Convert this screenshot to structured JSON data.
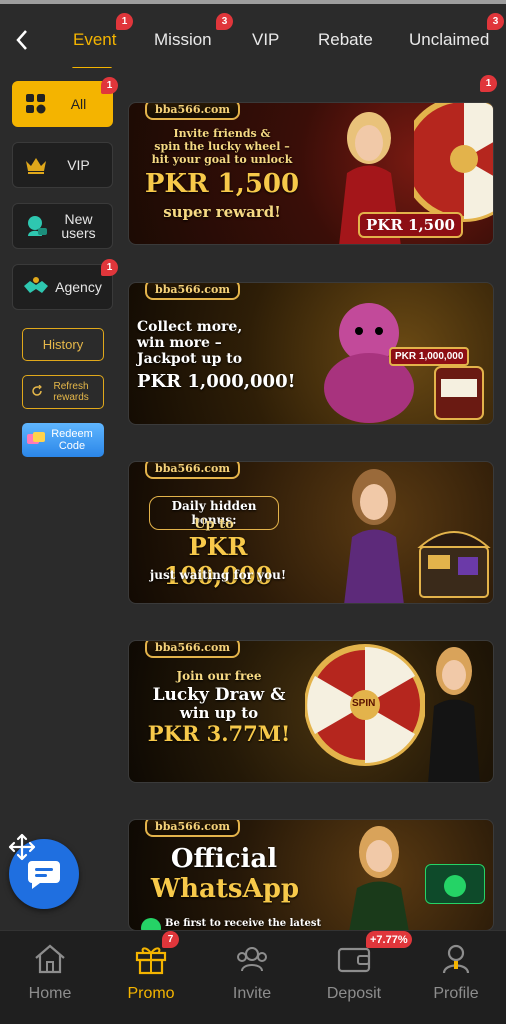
{
  "topbar": {
    "tabs": [
      {
        "label": "Event",
        "badge": "1"
      },
      {
        "label": "Mission",
        "badge": "3"
      },
      {
        "label": "VIP",
        "badge": ""
      },
      {
        "label": "Rebate",
        "badge": ""
      },
      {
        "label": "Unclaimed",
        "badge": "3"
      }
    ]
  },
  "sidebar": {
    "items": [
      {
        "label": "All",
        "badge": "1"
      },
      {
        "label": "VIP",
        "badge": ""
      },
      {
        "label": "New users",
        "badge": ""
      },
      {
        "label": "Agency",
        "badge": "1"
      }
    ],
    "history": "History",
    "refresh": "Refresh rewards",
    "redeem": "Redeem Code"
  },
  "banners": [
    {
      "logo": "bba566.com",
      "badge": "1",
      "lines": [
        "Invite friends &",
        "spin the lucky wheel –",
        "hit your goal to unlock",
        "PKR 1,500",
        "super reward!"
      ],
      "tag": "PKR 1,500"
    },
    {
      "logo": "bba566.com",
      "lines": [
        "Collect more,",
        "win more –",
        "Jackpot up to",
        "PKR 1,000,000!"
      ],
      "tag": "PKR 1,000,000"
    },
    {
      "logo": "bba566.com",
      "lines": [
        "Daily hidden bonus:",
        "Up to",
        "PKR 100,000",
        "just waiting for you!"
      ]
    },
    {
      "logo": "bba566.com",
      "lines": [
        "Join our free",
        "Lucky Draw &",
        "win up to",
        "PKR 3.77M!"
      ],
      "tag": "SPIN"
    },
    {
      "logo": "bba566.com",
      "lines": [
        "Official",
        "WhatsApp",
        "Be first to receive the latest"
      ]
    }
  ],
  "bottomnav": {
    "items": [
      {
        "label": "Home",
        "badge": ""
      },
      {
        "label": "Promo",
        "badge": "7"
      },
      {
        "label": "Invite",
        "badge": ""
      },
      {
        "label": "Deposit",
        "badge": "+7.77%"
      },
      {
        "label": "Profile",
        "badge": ""
      }
    ]
  },
  "colors": {
    "accent": "#f4b400",
    "badge": "#e0363b",
    "background": "#2b2b2b"
  }
}
